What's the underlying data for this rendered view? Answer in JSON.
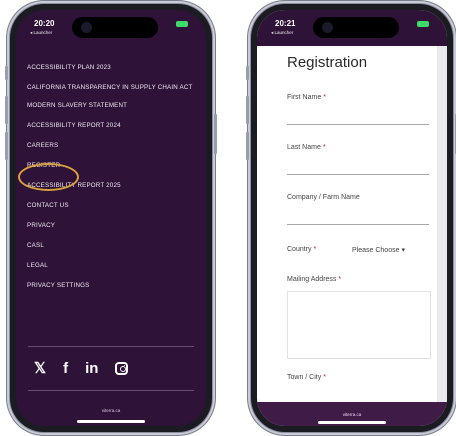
{
  "left_phone": {
    "time": "20:20",
    "launcher": "◂ Launcher",
    "menu": [
      "ACCESSIBILITY PLAN 2023",
      "CALIFORNIA TRANSPARENCY IN SUPPLY CHAIN ACT",
      "MODERN SLAVERY STATEMENT",
      "ACCESSIBILITY REPORT 2024",
      "CAREERS",
      "REGISTER",
      "ACCESSIBILITY REPORT 2025",
      "CONTACT US",
      "PRIVACY",
      "CASL",
      "LEGAL",
      "PRIVACY SETTINGS"
    ],
    "social": {
      "x": "𝕏",
      "facebook": "f",
      "linkedin": "in"
    },
    "footer": "viterra.ca"
  },
  "right_phone": {
    "time": "20:21",
    "launcher": "◂ Launcher",
    "title": "Registration",
    "fields": {
      "first_name": "First Name",
      "last_name": "Last Name",
      "company": "Company / Farm Name",
      "country": "Country",
      "mailing_address": "Mailing Address",
      "town_city": "Town / City"
    },
    "required_mark": "*",
    "country_placeholder": "Please Choose",
    "footer": "viterra.ca"
  },
  "colors": {
    "menu_bg": "#2e1237",
    "highlight": "#d9a23a",
    "required": "#c8102e"
  }
}
